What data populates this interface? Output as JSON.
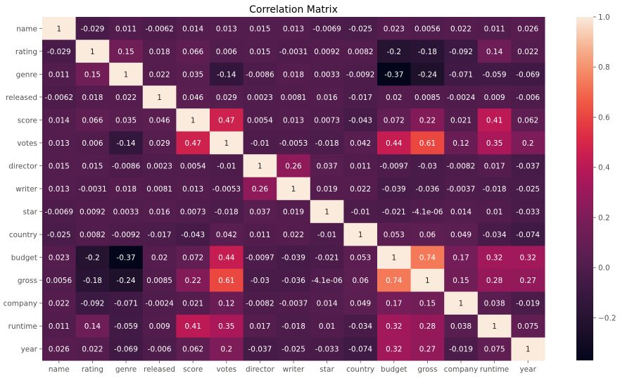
{
  "chart_data": {
    "type": "heatmap",
    "title": "Correlation Matrix",
    "xlabel": "",
    "ylabel": "",
    "colormap": "rocket",
    "vmin": -0.37,
    "vmax": 1.0,
    "labels": [
      "name",
      "rating",
      "genre",
      "released",
      "score",
      "votes",
      "director",
      "writer",
      "star",
      "country",
      "budget",
      "gross",
      "company",
      "runtime",
      "year"
    ],
    "values": [
      [
        1,
        -0.029,
        0.011,
        -0.0062,
        0.014,
        0.013,
        0.015,
        0.013,
        -0.0069,
        -0.025,
        0.023,
        0.0056,
        0.022,
        0.011,
        0.026
      ],
      [
        -0.029,
        1,
        0.15,
        0.018,
        0.066,
        0.006,
        0.015,
        -0.0031,
        0.0092,
        0.0082,
        -0.2,
        -0.18,
        -0.092,
        0.14,
        0.022
      ],
      [
        0.011,
        0.15,
        1,
        0.022,
        0.035,
        -0.14,
        -0.0086,
        0.018,
        0.0033,
        -0.0092,
        -0.37,
        -0.24,
        -0.071,
        -0.059,
        -0.069
      ],
      [
        -0.0062,
        0.018,
        0.022,
        1,
        0.046,
        0.029,
        0.0023,
        0.0081,
        0.016,
        -0.017,
        0.02,
        0.0085,
        -0.0024,
        0.009,
        -0.006
      ],
      [
        0.014,
        0.066,
        0.035,
        0.046,
        1,
        0.47,
        0.0054,
        0.013,
        0.0073,
        -0.043,
        0.072,
        0.22,
        0.021,
        0.41,
        0.062
      ],
      [
        0.013,
        0.006,
        -0.14,
        0.029,
        0.47,
        1,
        -0.01,
        -0.0053,
        -0.018,
        0.042,
        0.44,
        0.61,
        0.12,
        0.35,
        0.2
      ],
      [
        0.015,
        0.015,
        -0.0086,
        0.0023,
        0.0054,
        -0.01,
        1,
        0.26,
        0.037,
        0.011,
        -0.0097,
        -0.03,
        -0.0082,
        0.017,
        -0.037
      ],
      [
        0.013,
        -0.0031,
        0.018,
        0.0081,
        0.013,
        -0.0053,
        0.26,
        1,
        0.019,
        0.022,
        -0.039,
        -0.036,
        -0.0037,
        -0.018,
        -0.025
      ],
      [
        -0.0069,
        0.0092,
        0.0033,
        0.016,
        0.0073,
        -0.018,
        0.037,
        0.019,
        1,
        -0.01,
        -0.021,
        -4.1e-06,
        0.014,
        0.01,
        -0.033
      ],
      [
        -0.025,
        0.0082,
        -0.0092,
        -0.017,
        -0.043,
        0.042,
        0.011,
        0.022,
        -0.01,
        1,
        0.053,
        0.06,
        0.049,
        -0.034,
        -0.074
      ],
      [
        0.023,
        -0.2,
        -0.37,
        0.02,
        0.072,
        0.44,
        -0.0097,
        -0.039,
        -0.021,
        0.053,
        1,
        0.74,
        0.17,
        0.32,
        0.32
      ],
      [
        0.0056,
        -0.18,
        -0.24,
        0.0085,
        0.22,
        0.61,
        -0.03,
        -0.036,
        -4.1e-06,
        0.06,
        0.74,
        1,
        0.15,
        0.28,
        0.27
      ],
      [
        0.022,
        -0.092,
        -0.071,
        -0.0024,
        0.021,
        0.12,
        -0.0082,
        -0.0037,
        0.014,
        0.049,
        0.17,
        0.15,
        1,
        0.038,
        -0.019
      ],
      [
        0.011,
        0.14,
        -0.059,
        0.009,
        0.41,
        0.35,
        0.017,
        -0.018,
        0.01,
        -0.034,
        0.32,
        0.28,
        0.038,
        1,
        0.075
      ],
      [
        0.026,
        0.022,
        -0.069,
        -0.006,
        0.062,
        0.2,
        -0.037,
        -0.025,
        -0.033,
        -0.074,
        0.32,
        0.27,
        -0.019,
        0.075,
        1
      ]
    ],
    "annotations": [
      [
        "1",
        "-0.029",
        "0.011",
        "-0.0062",
        "0.014",
        "0.013",
        "0.015",
        "0.013",
        "-0.0069",
        "-0.025",
        "0.023",
        "0.0056",
        "0.022",
        "0.011",
        "0.026"
      ],
      [
        "-0.029",
        "1",
        "0.15",
        "0.018",
        "0.066",
        "0.006",
        "0.015",
        "-0.0031",
        "0.0092",
        "0.0082",
        "-0.2",
        "-0.18",
        "-0.092",
        "0.14",
        "0.022"
      ],
      [
        "0.011",
        "0.15",
        "1",
        "0.022",
        "0.035",
        "-0.14",
        "-0.0086",
        "0.018",
        "0.0033",
        "-0.0092",
        "-0.37",
        "-0.24",
        "-0.071",
        "-0.059",
        "-0.069"
      ],
      [
        "-0.0062",
        "0.018",
        "0.022",
        "1",
        "0.046",
        "0.029",
        "0.0023",
        "0.0081",
        "0.016",
        "-0.017",
        "0.02",
        "0.0085",
        "-0.0024",
        "0.009",
        "-0.006"
      ],
      [
        "0.014",
        "0.066",
        "0.035",
        "0.046",
        "1",
        "0.47",
        "0.0054",
        "0.013",
        "0.0073",
        "-0.043",
        "0.072",
        "0.22",
        "0.021",
        "0.41",
        "0.062"
      ],
      [
        "0.013",
        "0.006",
        "-0.14",
        "0.029",
        "0.47",
        "1",
        "-0.01",
        "-0.0053",
        "-0.018",
        "0.042",
        "0.44",
        "0.61",
        "0.12",
        "0.35",
        "0.2"
      ],
      [
        "0.015",
        "0.015",
        "-0.0086",
        "0.0023",
        "0.0054",
        "-0.01",
        "1",
        "0.26",
        "0.037",
        "0.011",
        "-0.0097",
        "-0.03",
        "-0.0082",
        "0.017",
        "-0.037"
      ],
      [
        "0.013",
        "-0.0031",
        "0.018",
        "0.0081",
        "0.013",
        "-0.0053",
        "0.26",
        "1",
        "0.019",
        "0.022",
        "-0.039",
        "-0.036",
        "-0.0037",
        "-0.018",
        "-0.025"
      ],
      [
        "-0.0069",
        "0.0092",
        "0.0033",
        "0.016",
        "0.0073",
        "-0.018",
        "0.037",
        "0.019",
        "1",
        "-0.01",
        "-0.021",
        "-4.1e-06",
        "0.014",
        "0.01",
        "-0.033"
      ],
      [
        "-0.025",
        "0.0082",
        "-0.0092",
        "-0.017",
        "-0.043",
        "0.042",
        "0.011",
        "0.022",
        "-0.01",
        "1",
        "0.053",
        "0.06",
        "0.049",
        "-0.034",
        "-0.074"
      ],
      [
        "0.023",
        "-0.2",
        "-0.37",
        "0.02",
        "0.072",
        "0.44",
        "-0.0097",
        "-0.039",
        "-0.021",
        "0.053",
        "1",
        "0.74",
        "0.17",
        "0.32",
        "0.32"
      ],
      [
        "0.0056",
        "-0.18",
        "-0.24",
        "0.0085",
        "0.22",
        "0.61",
        "-0.03",
        "-0.036",
        "-4.1e-06",
        "0.06",
        "0.74",
        "1",
        "0.15",
        "0.28",
        "0.27"
      ],
      [
        "0.022",
        "-0.092",
        "-0.071",
        "-0.0024",
        "0.021",
        "0.12",
        "-0.0082",
        "-0.0037",
        "0.014",
        "0.049",
        "0.17",
        "0.15",
        "1",
        "0.038",
        "-0.019"
      ],
      [
        "0.011",
        "0.14",
        "-0.059",
        "0.009",
        "0.41",
        "0.35",
        "0.017",
        "-0.018",
        "0.01",
        "-0.034",
        "0.32",
        "0.28",
        "0.038",
        "1",
        "0.075"
      ],
      [
        "0.026",
        "0.022",
        "-0.069",
        "-0.006",
        "0.062",
        "0.2",
        "-0.037",
        "-0.025",
        "-0.033",
        "-0.074",
        "0.32",
        "0.27",
        "-0.019",
        "0.075",
        "1"
      ]
    ],
    "colorbar": {
      "ticks": [
        1.0,
        0.8,
        0.6,
        0.4,
        0.2,
        0.0,
        -0.2
      ],
      "tick_labels": [
        "1.0",
        "0.8",
        "0.6",
        "0.4",
        "0.2",
        "0.0",
        "−0.2"
      ],
      "placement": "right"
    },
    "grid": false
  }
}
